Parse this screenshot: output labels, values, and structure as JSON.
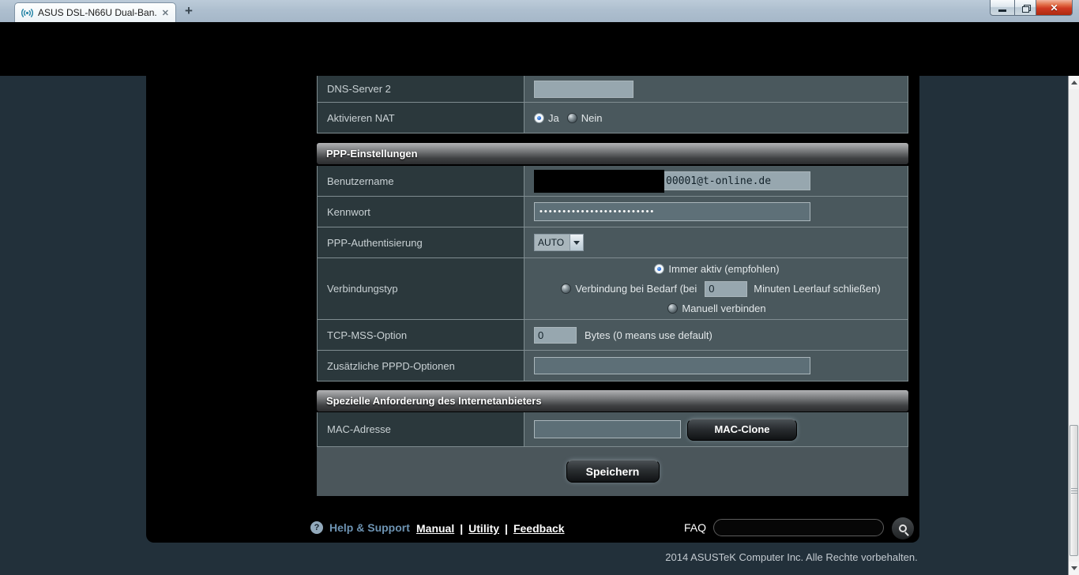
{
  "window": {
    "tab_title": "ASUS DSL-N66U Dual-Ban...",
    "icons": {
      "tab_close": "✕",
      "new_tab": "+",
      "window_close": "✕",
      "help": "?"
    }
  },
  "form": {
    "dns2": {
      "label": "DNS-Server 2",
      "value": ""
    },
    "nat": {
      "label": "Aktivieren NAT",
      "yes": "Ja",
      "no": "Nein"
    },
    "ppp_section": "PPP-Einstellungen",
    "username": {
      "label": "Benutzername",
      "value": "00001@t-online.de"
    },
    "password": {
      "label": "Kennwort",
      "masked": "•••••••••••••••••••••••••"
    },
    "auth": {
      "label": "PPP-Authentisierung",
      "value": "AUTO"
    },
    "conn": {
      "label": "Verbindungstyp",
      "opt1": "Immer aktiv (empfohlen)",
      "opt2_pre": "Verbindung bei Bedarf (bei",
      "opt2_value": "0",
      "opt2_post": "Minuten Leerlauf schließen)",
      "opt3": "Manuell verbinden"
    },
    "tcp_mss": {
      "label": "TCP-MSS-Option",
      "value": "0",
      "suffix": "Bytes (0 means use default)"
    },
    "pppd": {
      "label": "Zusätzliche PPPD-Optionen",
      "value": ""
    },
    "isp_section": "Spezielle Anforderung des Internetanbieters",
    "mac": {
      "label": "MAC-Adresse",
      "value": "",
      "button": "MAC-Clone"
    },
    "apply": "Speichern"
  },
  "footer": {
    "help": "Help & Support",
    "links": {
      "manual": "Manual",
      "utility": "Utility",
      "feedback": "Feedback"
    },
    "separator": "|",
    "faq_label": "FAQ",
    "faq_value": ""
  },
  "copyright": "2014 ASUSTeK Computer Inc. Alle Rechte vorbehalten.",
  "colors": {
    "accent_link": "#6d93b2",
    "label_cell": "#2b383c",
    "value_cell": "#4a585d",
    "input_dark": "#5d6f77",
    "input_light": "#97a7af",
    "close_button_red": "#cf3a22"
  }
}
